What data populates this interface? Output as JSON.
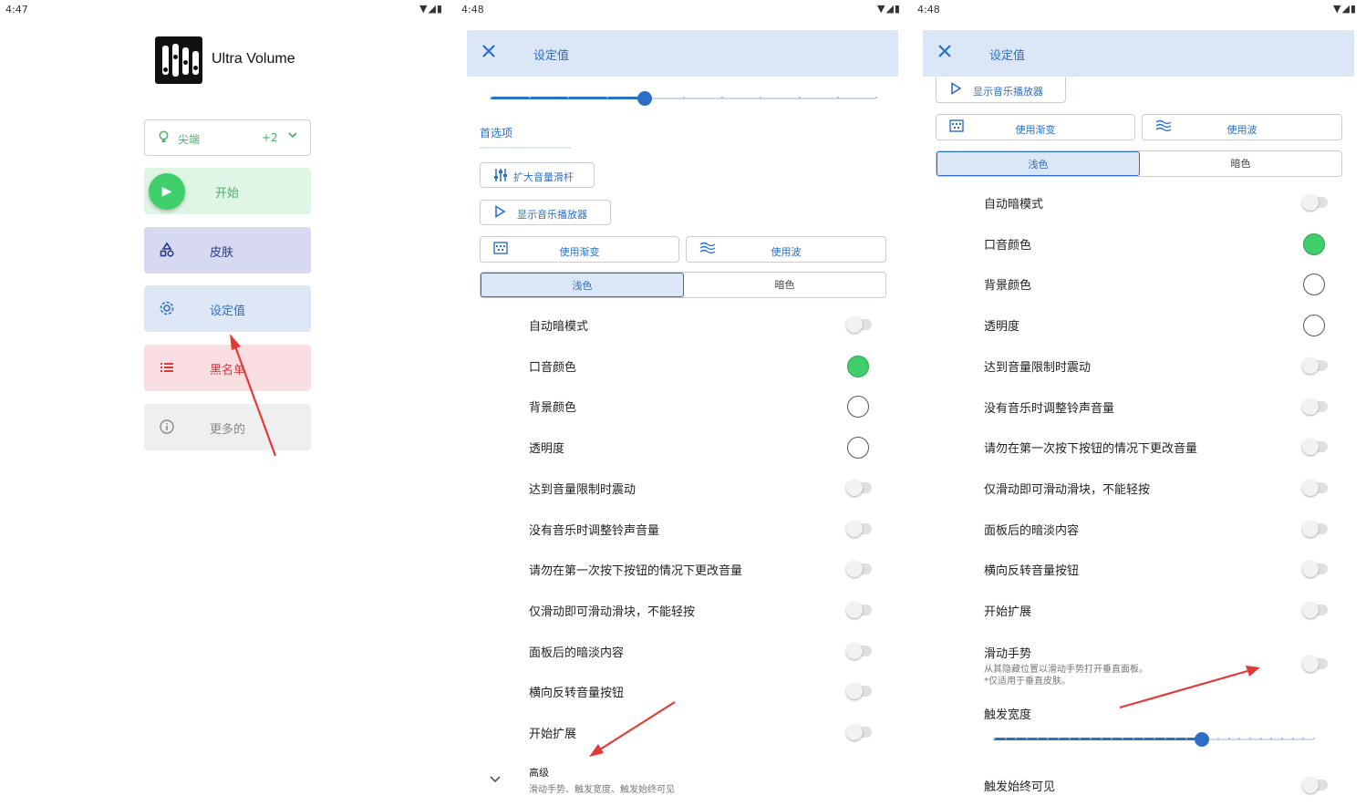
{
  "colors": {
    "accent": "#2c6fc6",
    "green": "#3ecf6b",
    "red_arrow": "#e53935"
  },
  "panel1": {
    "status": {
      "time": "4:47",
      "icons": "▼◢▮"
    },
    "app_title": "Ultra Volume",
    "tip_select": {
      "icon": "bulb-icon",
      "label": "尖端",
      "count": "+2"
    },
    "nav": {
      "start": "开始",
      "skin": "皮肤",
      "settings": "设定值",
      "blacklist": "黑名单",
      "more": "更多的"
    }
  },
  "panel2": {
    "status": {
      "time": "4:48",
      "icons": "▼◢▮"
    },
    "appbar_title": "设定值",
    "slider_value": 0.4,
    "pref_tab": "首选项",
    "chips": {
      "expand_slider": "扩大音量滑杆",
      "show_player": "显示音乐播放器"
    },
    "buttons": {
      "gradient": "使用渐变",
      "wave": "使用波"
    },
    "theme": {
      "light": "浅色",
      "dark": "暗色"
    },
    "settings": [
      "自动暗模式",
      "口音颜色",
      "背景颜色",
      "透明度",
      "达到音量限制时震动",
      "没有音乐时调整铃声音量",
      "请勿在第一次按下按钮的情况下更改音量",
      "仅滑动即可滑动滑块，不能轻按",
      "面板后的暗淡内容",
      "横向反转音量按钮",
      "开始扩展"
    ],
    "advanced": {
      "title": "高级",
      "subtitle": "滑动手势、触发宽度、触发始终可见"
    }
  },
  "panel3": {
    "status": {
      "time": "4:48",
      "icons": "▼◢▮"
    },
    "appbar_title": "设定值",
    "chips": {
      "show_player": "显示音乐播放器"
    },
    "buttons": {
      "gradient": "使用渐变",
      "wave": "使用波"
    },
    "theme": {
      "light": "浅色",
      "dark": "暗色"
    },
    "settings": [
      "自动暗模式",
      "口音颜色",
      "背景颜色",
      "透明度",
      "达到音量限制时震动",
      "没有音乐时调整铃声音量",
      "请勿在第一次按下按钮的情况下更改音量",
      "仅滑动即可滑动滑块，不能轻按",
      "面板后的暗淡内容",
      "横向反转音量按钮",
      "开始扩展"
    ],
    "swipe": {
      "title": "滑动手势",
      "desc1": "从其隐藏位置以滑动手势打开垂直面板。",
      "desc2": "*仅适用于垂直皮肤。"
    },
    "trigger_width": {
      "label": "触发宽度",
      "value": 0.65
    },
    "always_visible": "触发始终可见"
  }
}
